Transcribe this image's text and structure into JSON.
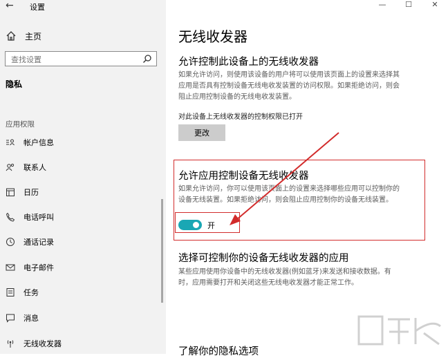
{
  "window": {
    "title": "设置",
    "controls": [
      "—",
      "☐",
      "✕"
    ]
  },
  "sidebar": {
    "home": "主页",
    "search_placeholder": "查找设置",
    "privacy": "隐私",
    "group": "应用权限",
    "items": [
      {
        "label": "帐户信息",
        "icon": "account-info-icon"
      },
      {
        "label": "联系人",
        "icon": "contacts-icon"
      },
      {
        "label": "日历",
        "icon": "calendar-icon"
      },
      {
        "label": "电话呼叫",
        "icon": "phone-icon"
      },
      {
        "label": "通话记录",
        "icon": "call-history-icon"
      },
      {
        "label": "电子邮件",
        "icon": "email-icon"
      },
      {
        "label": "任务",
        "icon": "tasks-icon"
      },
      {
        "label": "消息",
        "icon": "messaging-icon"
      },
      {
        "label": "无线收发器",
        "icon": "radios-icon"
      }
    ]
  },
  "main": {
    "title": "无线收发器",
    "section1": {
      "heading": "允许控制此设备上的无线收发器",
      "desc_line1": "如果允许访问，则使用该设备的用户将可以使用该页面上的设置来选择其",
      "desc_line2": "应用是否具有控制设备无线电收发装置的访问权限。如果拒绝访问，则会",
      "desc_line3": "阻止应用控制设备的无线电收发装置。",
      "status": "对此设备上无线收发器的控制权限已打开",
      "button": "更改"
    },
    "section2": {
      "heading": "允许应用控制设备无线收发器",
      "desc_line1": "如果允许访问，你可以使用该页面上的设置来选择哪些应用可以控制你的",
      "desc_line2": "设备无线装置。如果拒绝访问，则会阻止应用控制你的设备无线装置。",
      "toggle_label": "开",
      "toggle_on": true
    },
    "section3": {
      "heading": "选择可控制你的设备无线收发器的应用",
      "desc_line1": "某些应用使用你设备中的无线收发器(例如蓝牙)来发送和接收数据。有",
      "desc_line2": "时，应用需要打开和关闭这些无线电收发器才能正常工作。"
    },
    "section4": {
      "heading": "了解你的隐私选项"
    }
  },
  "colors": {
    "accent": "#1aa7b4",
    "highlight": "#d22b2b",
    "sidebar_bg": "#f2f2f2"
  }
}
